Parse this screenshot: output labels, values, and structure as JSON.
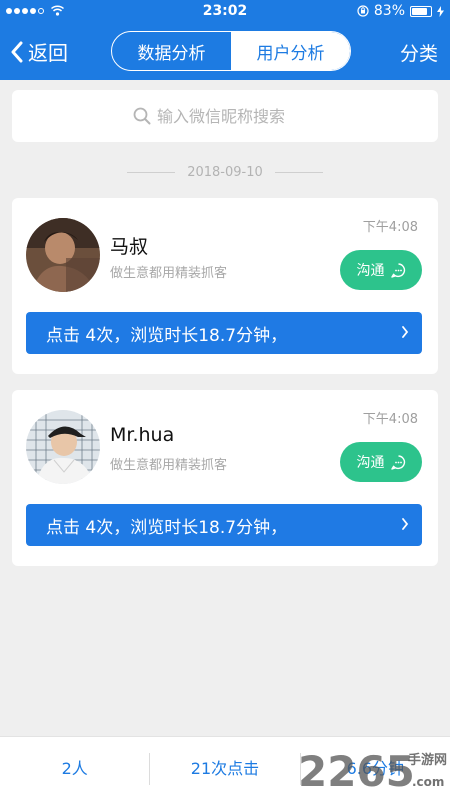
{
  "status_bar": {
    "time": "23:02",
    "battery": "83%",
    "battery_level": 0.83
  },
  "nav": {
    "back_label": "返回",
    "tabs": [
      {
        "label": "数据分析",
        "active": false
      },
      {
        "label": "用户分析",
        "active": true
      }
    ],
    "right_label": "分类"
  },
  "search": {
    "placeholder": "输入微信昵称搜索"
  },
  "date_divider": "2018-09-10",
  "users": [
    {
      "name": "马叔",
      "subtitle": "做生意都用精装抓客",
      "time": "下午4:08",
      "chat_label": "沟通",
      "stats": "点击 4次，浏览时长18.7分钟，"
    },
    {
      "name": "Mr.hua",
      "subtitle": "做生意都用精装抓客",
      "time": "下午4:08",
      "chat_label": "沟通",
      "stats": "点击 4次，浏览时长18.7分钟，"
    }
  ],
  "bottom_bar": {
    "people": "2人",
    "clicks": "21次点击",
    "duration": "6.6分钟"
  },
  "watermark": {
    "brand": "2265",
    "site": "手游网",
    "domain": ".com"
  },
  "colors": {
    "primary": "#1d7be2",
    "chat": "#2dc38c",
    "background": "#efefef"
  }
}
